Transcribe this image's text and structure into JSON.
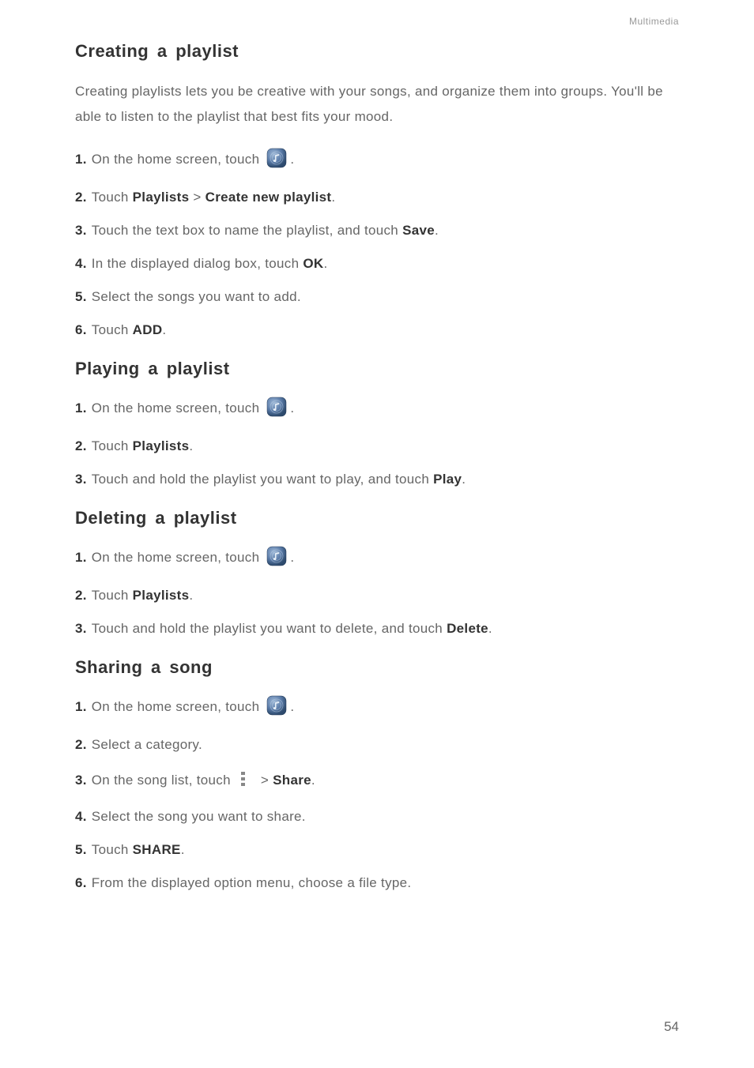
{
  "header": {
    "category": "Multimedia"
  },
  "sections": [
    {
      "heading": "Creating a playlist",
      "intro": "Creating playlists lets you be creative with your songs, and organize them into groups. You'll be able to listen to the playlist that best fits your mood.",
      "steps": [
        {
          "num": "1.",
          "parts": [
            {
              "t": "On the home screen, touch "
            },
            {
              "icon": "music"
            },
            {
              "t": "."
            }
          ]
        },
        {
          "num": "2.",
          "parts": [
            {
              "t": "Touch "
            },
            {
              "b": "Playlists"
            },
            {
              "t": " > "
            },
            {
              "b": "Create new playlist"
            },
            {
              "t": "."
            }
          ]
        },
        {
          "num": "3.",
          "parts": [
            {
              "t": "Touch the text box to name the playlist, and touch "
            },
            {
              "b": "Save"
            },
            {
              "t": "."
            }
          ]
        },
        {
          "num": "4.",
          "parts": [
            {
              "t": "In the displayed dialog box, touch "
            },
            {
              "b": "OK"
            },
            {
              "t": "."
            }
          ]
        },
        {
          "num": "5.",
          "parts": [
            {
              "t": "Select the songs you want to add."
            }
          ]
        },
        {
          "num": "6.",
          "parts": [
            {
              "t": "Touch "
            },
            {
              "b": "ADD"
            },
            {
              "t": "."
            }
          ]
        }
      ]
    },
    {
      "heading": "Playing a playlist",
      "steps": [
        {
          "num": "1.",
          "parts": [
            {
              "t": "On the home screen, touch "
            },
            {
              "icon": "music"
            },
            {
              "t": "."
            }
          ]
        },
        {
          "num": "2.",
          "parts": [
            {
              "t": "Touch "
            },
            {
              "b": "Playlists"
            },
            {
              "t": "."
            }
          ]
        },
        {
          "num": "3.",
          "parts": [
            {
              "t": "Touch and hold the playlist you want to play, and touch "
            },
            {
              "b": "Play"
            },
            {
              "t": "."
            }
          ]
        }
      ]
    },
    {
      "heading": "Deleting a playlist",
      "steps": [
        {
          "num": "1.",
          "parts": [
            {
              "t": "On the home screen, touch "
            },
            {
              "icon": "music"
            },
            {
              "t": "."
            }
          ]
        },
        {
          "num": "2.",
          "parts": [
            {
              "t": "Touch "
            },
            {
              "b": "Playlists"
            },
            {
              "t": "."
            }
          ]
        },
        {
          "num": "3.",
          "parts": [
            {
              "t": "Touch and hold the playlist you want to delete, and touch "
            },
            {
              "b": "Delete"
            },
            {
              "t": "."
            }
          ]
        }
      ]
    },
    {
      "heading": "Sharing a song",
      "steps": [
        {
          "num": "1.",
          "parts": [
            {
              "t": "On the home screen, touch "
            },
            {
              "icon": "music"
            },
            {
              "t": "."
            }
          ]
        },
        {
          "num": "2.",
          "parts": [
            {
              "t": "Select a category."
            }
          ]
        },
        {
          "num": "3.",
          "parts": [
            {
              "t": "On the song list, touch "
            },
            {
              "icon": "overflow"
            },
            {
              "t": " > "
            },
            {
              "b": "Share"
            },
            {
              "t": "."
            }
          ]
        },
        {
          "num": "4.",
          "parts": [
            {
              "t": "Select the song you want to share."
            }
          ]
        },
        {
          "num": "5.",
          "parts": [
            {
              "t": "Touch "
            },
            {
              "b": "SHARE"
            },
            {
              "t": "."
            }
          ]
        },
        {
          "num": "6.",
          "parts": [
            {
              "t": "From the displayed option menu, choose a file type."
            }
          ]
        }
      ]
    }
  ],
  "pageNumber": "54"
}
